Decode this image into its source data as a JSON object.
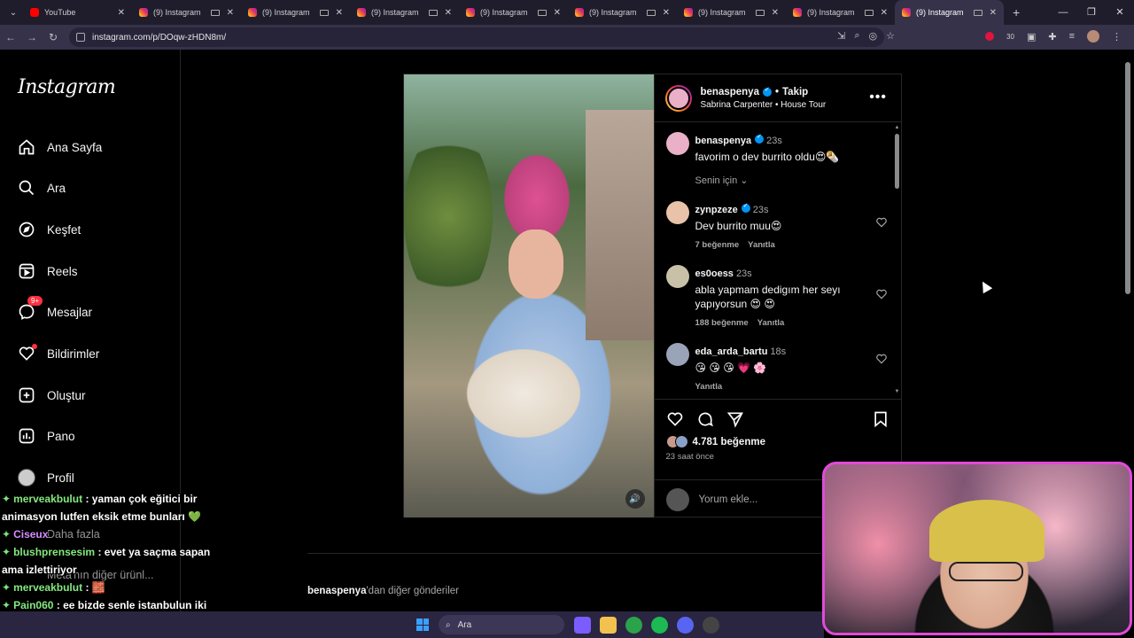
{
  "browser": {
    "tabs": [
      {
        "title": "YouTube",
        "favicon": "youtube-favicon",
        "active": false
      },
      {
        "title": "(9) Instagram",
        "favicon": "instagram-favicon",
        "active": false
      },
      {
        "title": "(9) Instagram",
        "favicon": "instagram-favicon",
        "active": false
      },
      {
        "title": "(9) Instagram",
        "favicon": "instagram-favicon",
        "active": false
      },
      {
        "title": "(9) Instagram",
        "favicon": "instagram-favicon",
        "active": false
      },
      {
        "title": "(9) Instagram",
        "favicon": "instagram-favicon",
        "active": false
      },
      {
        "title": "(9) Instagram",
        "favicon": "instagram-favicon",
        "active": false
      },
      {
        "title": "(9) Instagram",
        "favicon": "instagram-favicon",
        "active": false
      },
      {
        "title": "(9) Instagram",
        "favicon": "instagram-favicon",
        "active": true
      }
    ],
    "url": "instagram.com/p/DOqw-zHDN8m/",
    "extension_badge": "30"
  },
  "sidebar": {
    "logo": "Instagram",
    "items": [
      {
        "label": "Ana Sayfa",
        "icon": "home-icon"
      },
      {
        "label": "Ara",
        "icon": "search-icon"
      },
      {
        "label": "Keşfet",
        "icon": "compass-icon"
      },
      {
        "label": "Reels",
        "icon": "reels-icon"
      },
      {
        "label": "Mesajlar",
        "icon": "messenger-icon",
        "badge": "9+"
      },
      {
        "label": "Bildirimler",
        "icon": "heart-icon"
      },
      {
        "label": "Oluştur",
        "icon": "plus-square-icon"
      },
      {
        "label": "Pano",
        "icon": "dashboard-icon"
      },
      {
        "label": "Profil",
        "icon": "avatar"
      },
      {
        "label": "Daha fazla",
        "icon": "menu-icon"
      },
      {
        "label": "Meta'nın diğer ürünl...",
        "icon": "grid-icon"
      }
    ]
  },
  "post": {
    "username": "benaspenya",
    "follow_label": "Takip",
    "audio": "Sabrina Carpenter • House Tour",
    "caption": {
      "user": "benaspenya",
      "time": "23s",
      "text": "favorim o dev burrito oldu😍🌯"
    },
    "sort_label": "Senin için",
    "comments": [
      {
        "user": "zynpzeze",
        "verified": true,
        "time": "23s",
        "text": "Dev burrito muu😍",
        "likes": "7 beğenme",
        "reply": "Yanıtla",
        "avatar_color": "#e8c3a9"
      },
      {
        "user": "es0oess",
        "verified": false,
        "time": "23s",
        "text": "abla yapmam dedigım her seyı yapıyorsun 😍 😍",
        "likes": "188 beğenme",
        "reply": "Yanıtla",
        "avatar_color": "#c9c0a8"
      },
      {
        "user": "eda_arda_bartu",
        "verified": false,
        "time": "18s",
        "text": "😘 😘 😘 💗 🌸",
        "likes": "",
        "reply": "Yanıtla",
        "avatar_color": "#9aa4b8"
      }
    ],
    "like_count": "4.781 beğenme",
    "time_ago": "23 saat önce",
    "comment_placeholder": "Yorum ekle..."
  },
  "more_posts": {
    "user": "benaspenya",
    "suffix": "'dan diğer gönderiler"
  },
  "chat": [
    {
      "user": "merveakbulut",
      "text": ": yaman çok eğitici bir animasyon lutfen eksik etme bunları 💚",
      "color": "#85e97f"
    },
    {
      "user": "Ciseux",
      "text": "",
      "color": "#d88cff"
    },
    {
      "user": "blushprensesim",
      "text": ": evet ya saçma sapan ama izlettiriyor",
      "color": "#85e97f"
    },
    {
      "user": "merveakbulut",
      "text": ": 🧱",
      "color": "#85e97f"
    },
    {
      "user": "Pain060",
      "text": ": ee bizde senle istanbulun iki farklı ucundayız @Blush bozar mı",
      "color": "#85e97f"
    }
  ],
  "taskbar": {
    "search_placeholder": "Ara"
  }
}
